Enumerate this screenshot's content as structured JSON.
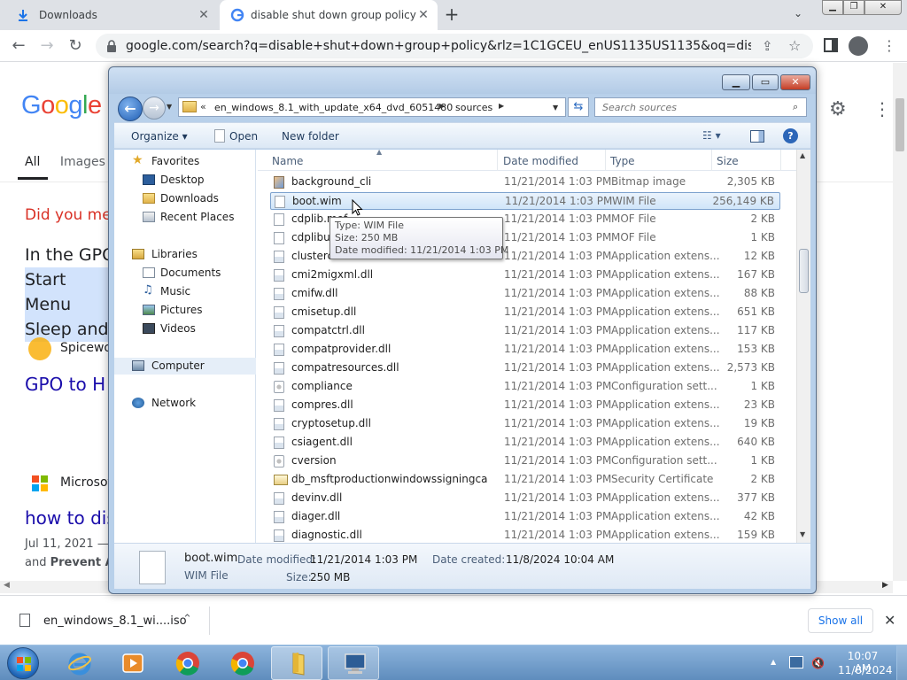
{
  "browser": {
    "tabs": [
      {
        "title": "Downloads",
        "icon": "download-icon"
      },
      {
        "title": "disable shut down group policy",
        "icon": "google-icon"
      }
    ],
    "new_tab": "+",
    "url": "google.com/search?q=disable+shut+down+group+policy&rlz=1C1GCEU_enUS1135US1135&oq=disable+shut+..."
  },
  "google": {
    "logo": "Google",
    "tabs": [
      "All",
      "Images"
    ],
    "did_you_mean": "Did you mea",
    "snippet_line1": "In the GPO",
    "snippet_line2": "Start Menu",
    "snippet_line3": "Sleep and",
    "source1": "Spicewor",
    "result1": "GPO to H",
    "source2": "Microsof",
    "result2": "how to dis",
    "date": "Jul 11, 2021 —",
    "snippet2_prefix": "and ",
    "snippet2_bold": "Prevent A"
  },
  "downloads_bar": {
    "file": "en_windows_8.1_wi....iso",
    "show_all": "Show all"
  },
  "explorer": {
    "address": {
      "crumb1": "en_windows_8.1_with_update_x64_dvd_6051480",
      "crumb2": "sources"
    },
    "search_placeholder": "Search sources",
    "toolbar": {
      "organize": "Organize ▾",
      "open": "Open",
      "new_folder": "New folder"
    },
    "nav": {
      "favorites": "Favorites",
      "desktop": "Desktop",
      "downloads": "Downloads",
      "recent": "Recent Places",
      "libraries": "Libraries",
      "documents": "Documents",
      "music": "Music",
      "pictures": "Pictures",
      "videos": "Videos",
      "computer": "Computer",
      "network": "Network"
    },
    "columns": {
      "name": "Name",
      "date": "Date modified",
      "type": "Type",
      "size": "Size"
    },
    "files": [
      {
        "name": "background_cli",
        "date": "11/21/2014 1:03 PM",
        "type": "Bitmap image",
        "size": "2,305 KB",
        "icon": "bmp"
      },
      {
        "name": "boot.wim",
        "date": "11/21/2014 1:03 PM",
        "type": "WIM File",
        "size": "256,149 KB",
        "icon": "file",
        "selected": true
      },
      {
        "name": "cdplib.mof",
        "date": "11/21/2014 1:03 PM",
        "type": "MOF File",
        "size": "2 KB",
        "icon": "file"
      },
      {
        "name": "cdplibuninstall.mof",
        "date": "11/21/2014 1:03 PM",
        "type": "MOF File",
        "size": "1 KB",
        "icon": "file"
      },
      {
        "name": "clustercommon.dll",
        "date": "11/21/2014 1:03 PM",
        "type": "Application extens...",
        "size": "12 KB",
        "icon": "dll"
      },
      {
        "name": "cmi2migxml.dll",
        "date": "11/21/2014 1:03 PM",
        "type": "Application extens...",
        "size": "167 KB",
        "icon": "dll"
      },
      {
        "name": "cmifw.dll",
        "date": "11/21/2014 1:03 PM",
        "type": "Application extens...",
        "size": "88 KB",
        "icon": "dll"
      },
      {
        "name": "cmisetup.dll",
        "date": "11/21/2014 1:03 PM",
        "type": "Application extens...",
        "size": "651 KB",
        "icon": "dll"
      },
      {
        "name": "compatctrl.dll",
        "date": "11/21/2014 1:03 PM",
        "type": "Application extens...",
        "size": "117 KB",
        "icon": "dll"
      },
      {
        "name": "compatprovider.dll",
        "date": "11/21/2014 1:03 PM",
        "type": "Application extens...",
        "size": "153 KB",
        "icon": "dll"
      },
      {
        "name": "compatresources.dll",
        "date": "11/21/2014 1:03 PM",
        "type": "Application extens...",
        "size": "2,573 KB",
        "icon": "dll"
      },
      {
        "name": "compliance",
        "date": "11/21/2014 1:03 PM",
        "type": "Configuration sett...",
        "size": "1 KB",
        "icon": "cfg"
      },
      {
        "name": "compres.dll",
        "date": "11/21/2014 1:03 PM",
        "type": "Application extens...",
        "size": "23 KB",
        "icon": "dll"
      },
      {
        "name": "cryptosetup.dll",
        "date": "11/21/2014 1:03 PM",
        "type": "Application extens...",
        "size": "19 KB",
        "icon": "dll"
      },
      {
        "name": "csiagent.dll",
        "date": "11/21/2014 1:03 PM",
        "type": "Application extens...",
        "size": "640 KB",
        "icon": "dll"
      },
      {
        "name": "cversion",
        "date": "11/21/2014 1:03 PM",
        "type": "Configuration sett...",
        "size": "1 KB",
        "icon": "cfg"
      },
      {
        "name": "db_msftproductionwindowssigningca",
        "date": "11/21/2014 1:03 PM",
        "type": "Security Certificate",
        "size": "2 KB",
        "icon": "cert"
      },
      {
        "name": "devinv.dll",
        "date": "11/21/2014 1:03 PM",
        "type": "Application extens...",
        "size": "377 KB",
        "icon": "dll"
      },
      {
        "name": "diager.dll",
        "date": "11/21/2014 1:03 PM",
        "type": "Application extens...",
        "size": "42 KB",
        "icon": "dll"
      },
      {
        "name": "diagnostic.dll",
        "date": "11/21/2014 1:03 PM",
        "type": "Application extens...",
        "size": "159 KB",
        "icon": "dll"
      }
    ],
    "tooltip": {
      "type": "Type: WIM File",
      "size": "Size: 250 MB",
      "date": "Date modified: 11/21/2014 1:03 PM"
    },
    "details": {
      "name": "boot.wim",
      "type": "WIM File",
      "modified_label": "Date modified:",
      "modified": "11/21/2014 1:03 PM",
      "size_label": "Size:",
      "size": "250 MB",
      "created_label": "Date created:",
      "created": "11/8/2024 10:04 AM"
    }
  },
  "taskbar": {
    "time": "10:07 AM",
    "date": "11/8/2024"
  },
  "colors": {
    "explorer_frame": "#b8d0ea",
    "selection": "#d0e5f9",
    "taskbar": "#5f8dbd",
    "google_link": "#1a0dab"
  }
}
